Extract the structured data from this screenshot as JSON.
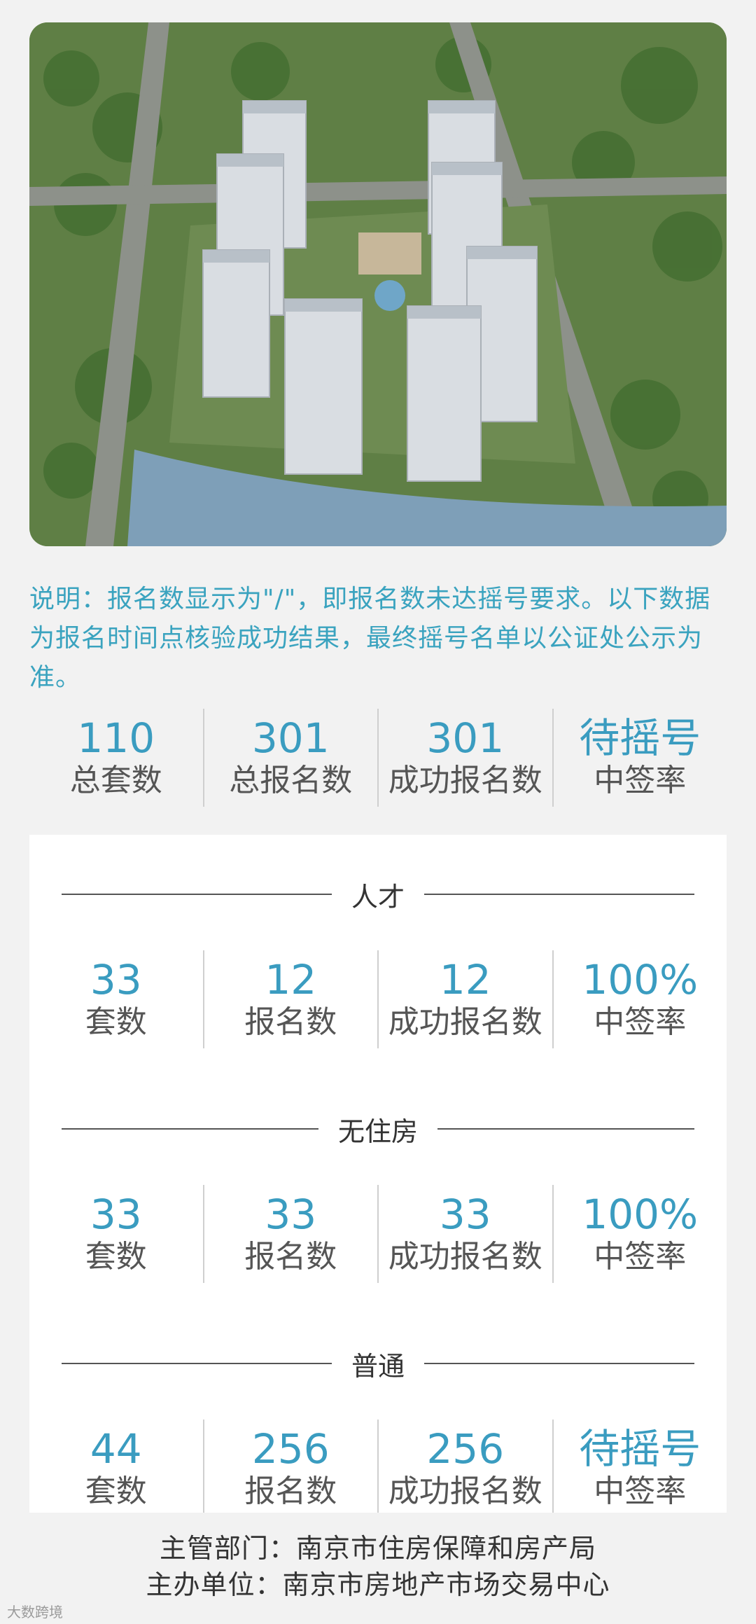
{
  "note": "说明：报名数显示为\"/\"，即报名数未达摇号要求。以下数据为报名时间点核验成功结果，最终摇号名单以公证处公示为准。",
  "summary": [
    {
      "value": "110",
      "label": "总套数"
    },
    {
      "value": "301",
      "label": "总报名数"
    },
    {
      "value": "301",
      "label": "成功报名数"
    },
    {
      "value": "待摇号",
      "label": "中签率"
    }
  ],
  "sections": [
    {
      "title": "人才",
      "stats": [
        {
          "value": "33",
          "label": "套数"
        },
        {
          "value": "12",
          "label": "报名数"
        },
        {
          "value": "12",
          "label": "成功报名数"
        },
        {
          "value": "100%",
          "label": "中签率"
        }
      ]
    },
    {
      "title": "无住房",
      "stats": [
        {
          "value": "33",
          "label": "套数"
        },
        {
          "value": "33",
          "label": "报名数"
        },
        {
          "value": "33",
          "label": "成功报名数"
        },
        {
          "value": "100%",
          "label": "中签率"
        }
      ]
    },
    {
      "title": "普通",
      "stats": [
        {
          "value": "44",
          "label": "套数"
        },
        {
          "value": "256",
          "label": "报名数"
        },
        {
          "value": "256",
          "label": "成功报名数"
        },
        {
          "value": "待摇号",
          "label": "中签率"
        }
      ]
    }
  ],
  "footer": {
    "line1": "主管部门：南京市住房保障和房产局",
    "line2": "主办单位：南京市房地产市场交易中心"
  },
  "watermark": "大数跨境",
  "colors": {
    "accent": "#3a9cc0",
    "background": "#f2f2f2"
  }
}
